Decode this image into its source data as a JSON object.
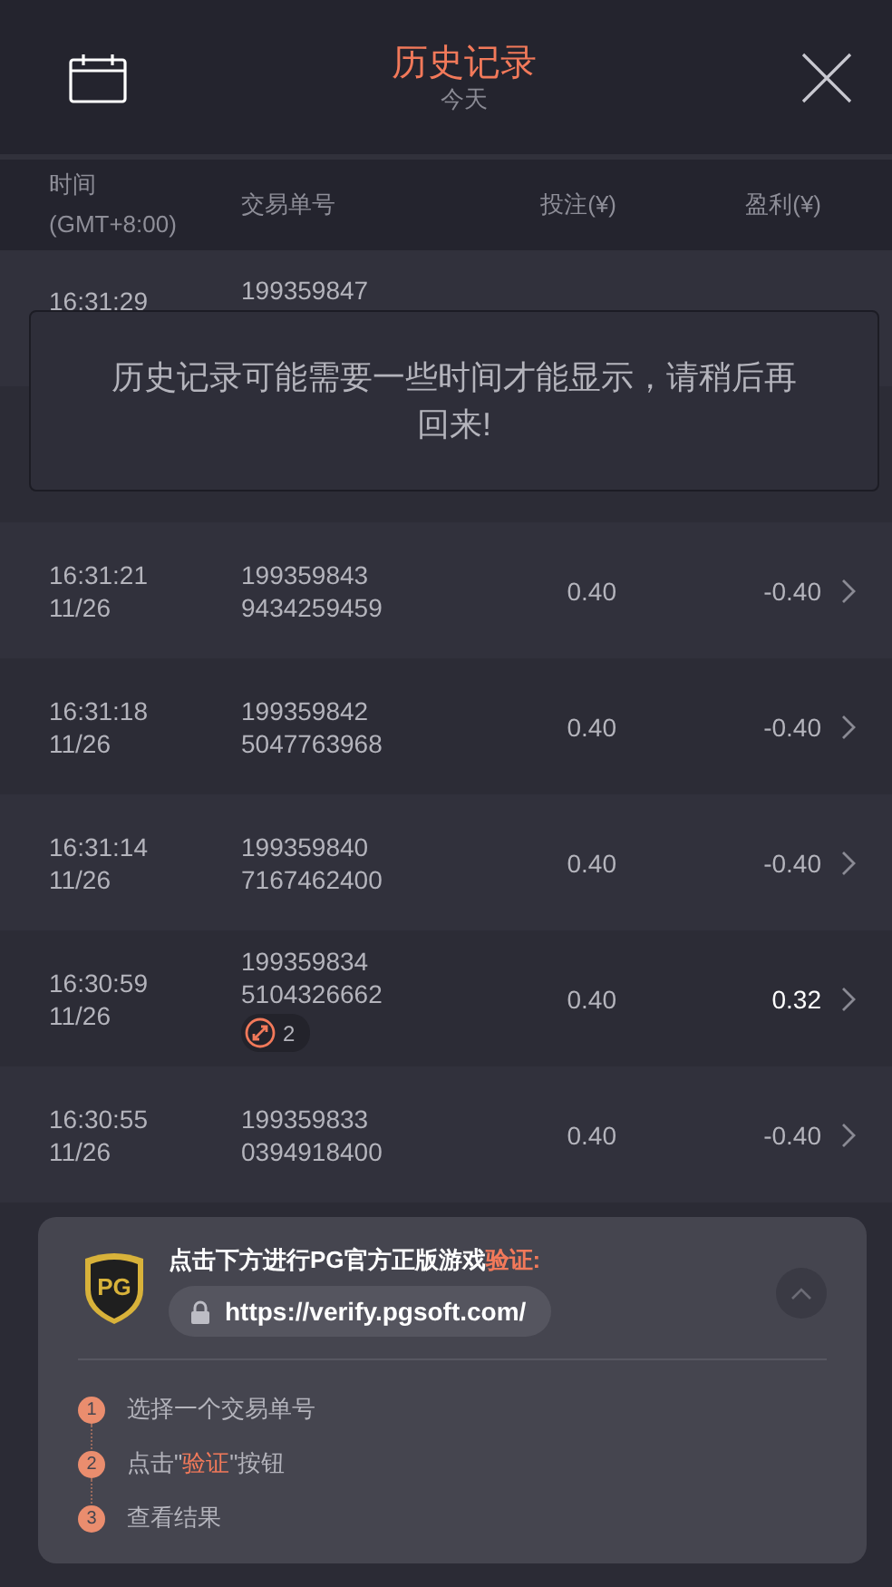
{
  "header": {
    "title": "历史记录",
    "subtitle": "今天"
  },
  "columns": {
    "time_label": "时间",
    "time_zone": "(GMT+8:00)",
    "order": "交易单号",
    "bet": "投注(¥)",
    "profit": "盈利(¥)"
  },
  "notice": {
    "text": "历史记录可能需要一些时间才能显示，请稍后再回来!"
  },
  "rows": [
    {
      "kind": "covered",
      "time": "16:31:29",
      "id_line1": "199359847"
    },
    {
      "kind": "hidden"
    },
    {
      "kind": "full",
      "time": "16:31:21",
      "date": "11/26",
      "id_line1": "199359843",
      "id_line2": "9434259459",
      "bet": "0.40",
      "profit": "-0.40",
      "highlight": false
    },
    {
      "kind": "full",
      "time": "16:31:18",
      "date": "11/26",
      "id_line1": "199359842",
      "id_line2": "5047763968",
      "bet": "0.40",
      "profit": "-0.40",
      "highlight": false
    },
    {
      "kind": "full",
      "time": "16:31:14",
      "date": "11/26",
      "id_line1": "199359840",
      "id_line2": "7167462400",
      "bet": "0.40",
      "profit": "-0.40",
      "highlight": false
    },
    {
      "kind": "full",
      "time": "16:30:59",
      "date": "11/26",
      "id_line1": "199359834",
      "id_line2": "5104326662",
      "badge": "2",
      "bet": "0.40",
      "profit": "0.32",
      "highlight": true
    },
    {
      "kind": "full",
      "time": "16:30:55",
      "date": "11/26",
      "id_line1": "199359833",
      "id_line2": "0394918400",
      "bet": "0.40",
      "profit": "-0.40",
      "highlight": false
    }
  ],
  "verify": {
    "title": "点击下方进行PG官方正版游戏**验证:**",
    "logo": "PG",
    "url": "https://verify.pgsoft.com/",
    "expanded": true,
    "steps": [
      {
        "number": "1",
        "text": "选择一个交易单号"
      },
      {
        "number": "2",
        "text": "点击\"**验证**\"按钮"
      },
      {
        "number": "3",
        "text": "查看结果"
      }
    ]
  }
}
